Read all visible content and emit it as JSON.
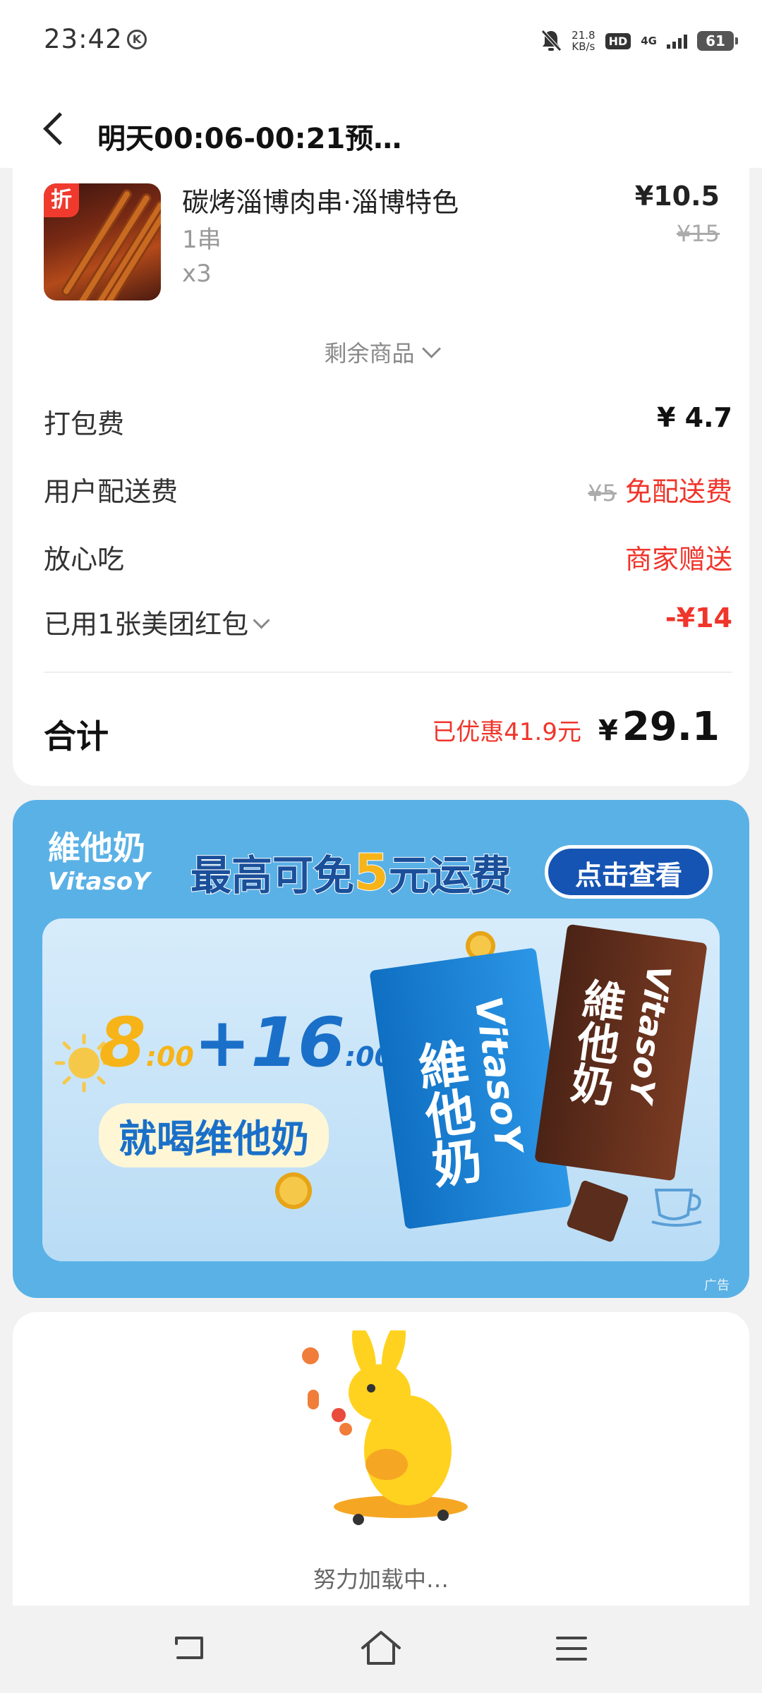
{
  "status_bar": {
    "time": "23:42",
    "net_speed_value": "21.8",
    "net_speed_unit": "KB/s",
    "hd_label": "HD",
    "network": "4G",
    "battery": "61"
  },
  "header": {
    "title": "明天00:06-00:21预…"
  },
  "order_item": {
    "discount_tag": "折",
    "name": "碳烤淄博肉串·淄博特色",
    "spec": "1串",
    "quantity": "x3",
    "price": "¥10.5",
    "original_price": "¥15"
  },
  "more_items_label": "剩余商品",
  "fees": [
    {
      "label": "打包费",
      "value": "¥ 4.7"
    },
    {
      "label": "用户配送费",
      "original": "¥5",
      "value": "免配送费"
    },
    {
      "label": "放心吃",
      "value": "商家赠送"
    },
    {
      "label": "已用1张美团红包",
      "value": "-¥14"
    }
  ],
  "total": {
    "label": "合计",
    "saved": "已优惠41.9元",
    "currency": "¥",
    "amount": "29.1"
  },
  "ad": {
    "brand_cn": "維他奶",
    "brand_latin": "VitasoY",
    "slogan_prefix": "最高可免",
    "slogan_number": "5",
    "slogan_suffix": "元运费",
    "button": "点击查看",
    "headline_a": "8",
    "headline_a_unit": ":00",
    "headline_plus": "+",
    "headline_b": "16",
    "headline_b_unit": ":00",
    "headline_sub": "就喝维他奶",
    "pack_blue_cn": "維他奶",
    "pack_blue_latin": "VitasoY",
    "pack_brown_cn": "維他奶",
    "pack_brown_latin": "VitasoY",
    "ad_label": "广告"
  },
  "loading": {
    "text": "努力加载中…"
  },
  "colors": {
    "accent_red": "#f0352b",
    "ad_blue": "#5ab1e6",
    "page_bg": "#f2f2f2"
  }
}
